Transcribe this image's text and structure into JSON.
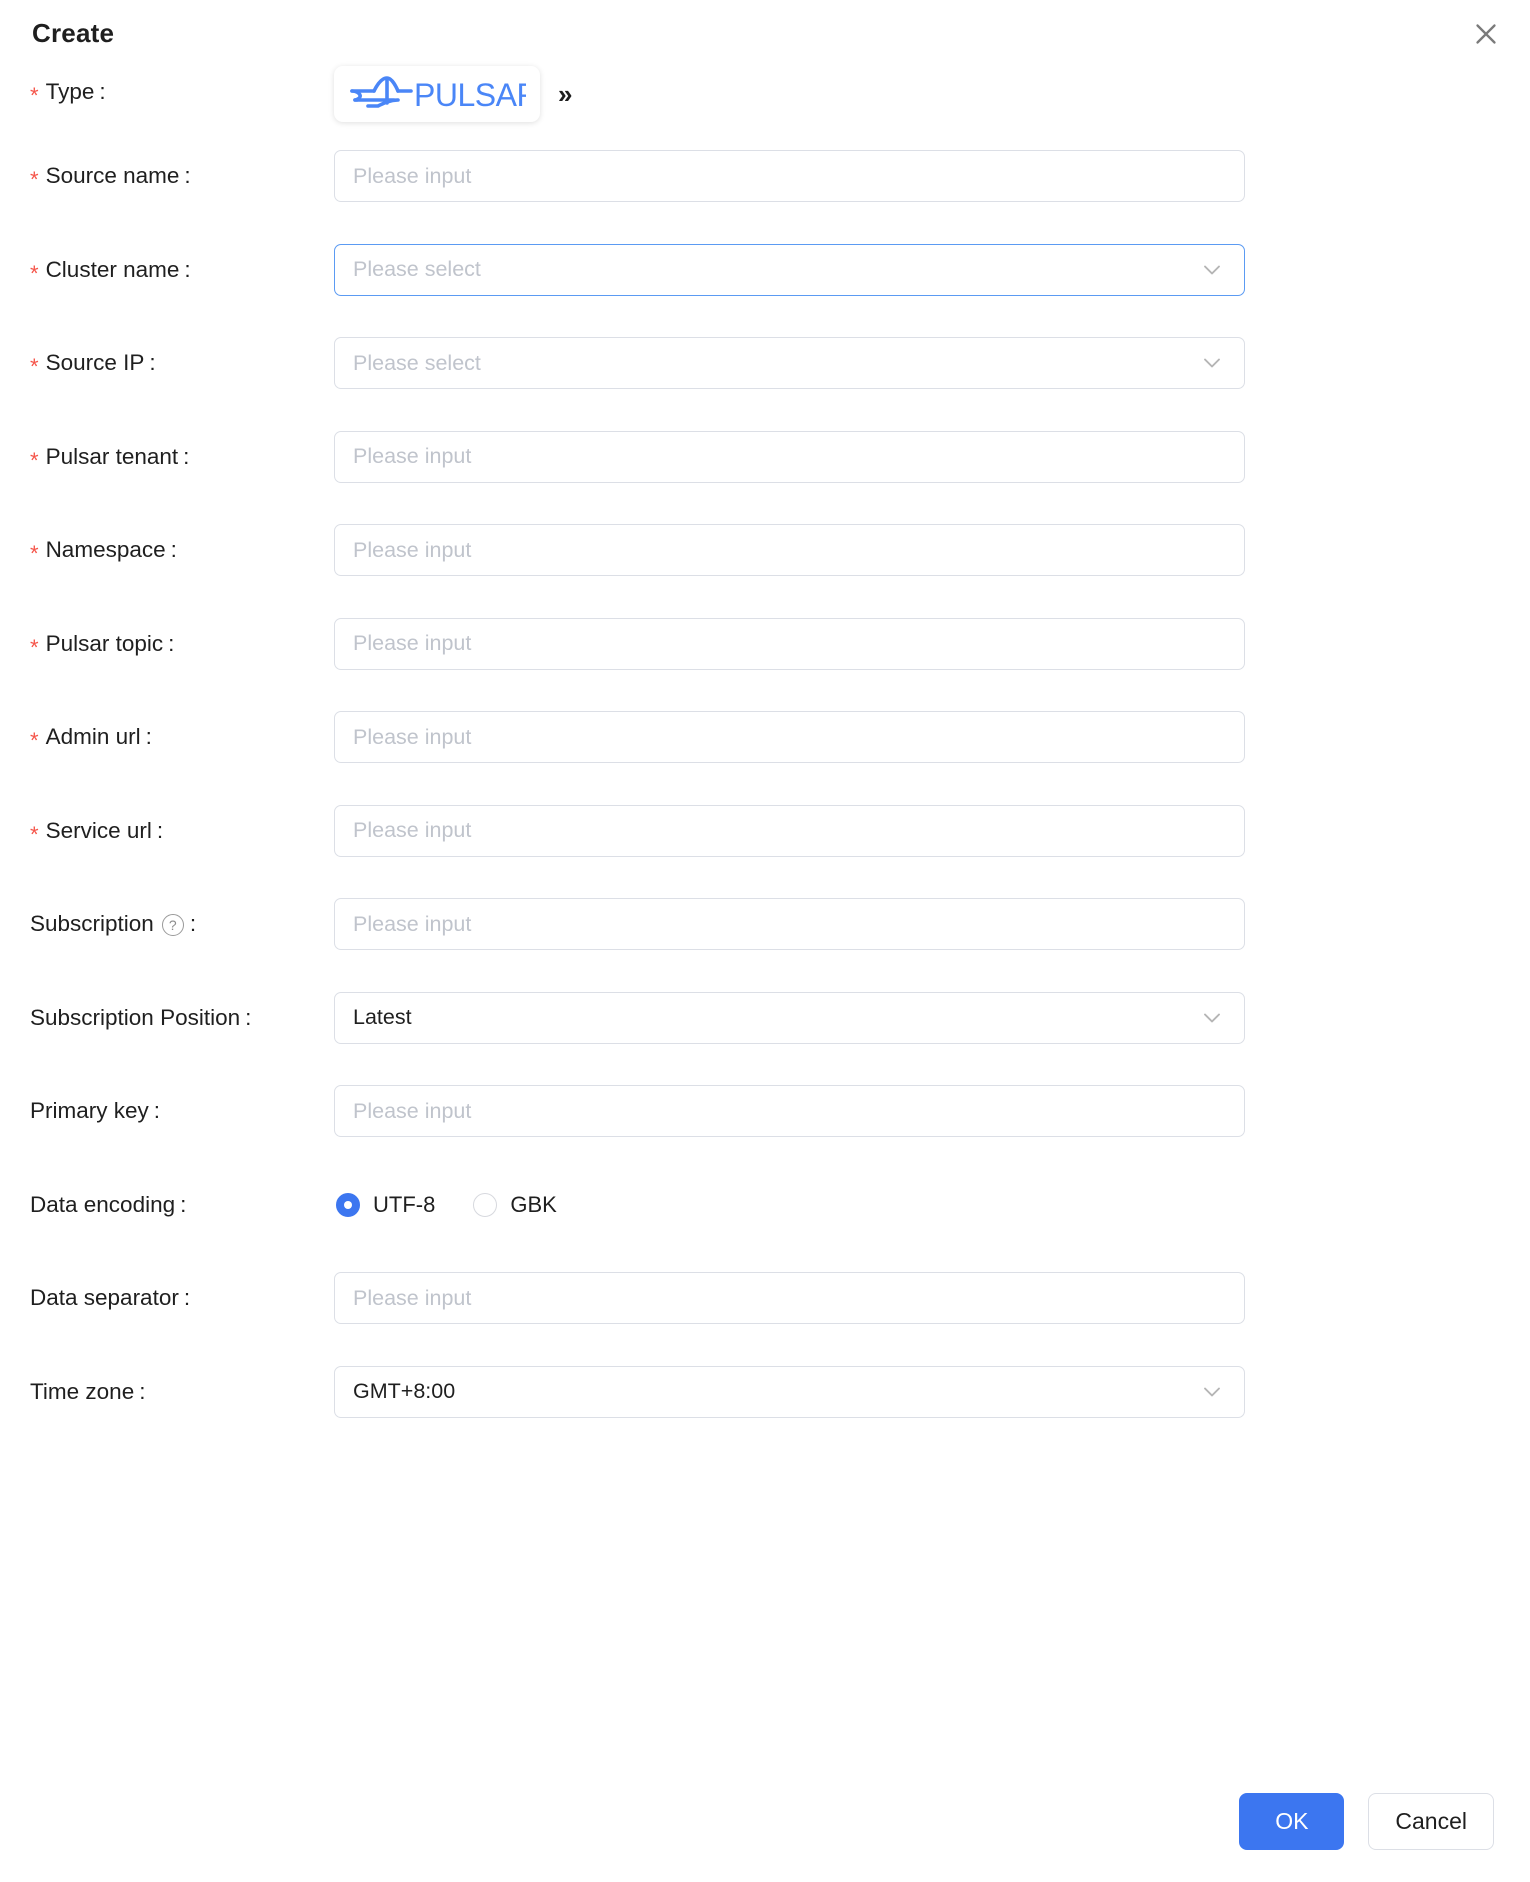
{
  "dialog": {
    "title": "Create",
    "close_icon": "close-icon"
  },
  "form": {
    "type": {
      "label": "Type",
      "required": true,
      "selected_logo_text": "PULSAR",
      "next_arrow": "»"
    },
    "fields": [
      {
        "key": "source_name",
        "label": "Source name",
        "required": true,
        "control": "input",
        "placeholder": "Please input",
        "value": ""
      },
      {
        "key": "cluster_name",
        "label": "Cluster name",
        "required": true,
        "control": "select",
        "placeholder": "Please select",
        "value": "",
        "focused": true
      },
      {
        "key": "source_ip",
        "label": "Source IP",
        "required": true,
        "control": "select",
        "placeholder": "Please select",
        "value": ""
      },
      {
        "key": "pulsar_tenant",
        "label": "Pulsar tenant",
        "required": true,
        "control": "input",
        "placeholder": "Please input",
        "value": ""
      },
      {
        "key": "namespace",
        "label": "Namespace",
        "required": true,
        "control": "input",
        "placeholder": "Please input",
        "value": ""
      },
      {
        "key": "pulsar_topic",
        "label": "Pulsar topic",
        "required": true,
        "control": "input",
        "placeholder": "Please input",
        "value": ""
      },
      {
        "key": "admin_url",
        "label": "Admin url",
        "required": true,
        "control": "input",
        "placeholder": "Please input",
        "value": ""
      },
      {
        "key": "service_url",
        "label": "Service url",
        "required": true,
        "control": "input",
        "placeholder": "Please input",
        "value": ""
      },
      {
        "key": "subscription",
        "label": "Subscription",
        "required": false,
        "control": "input",
        "placeholder": "Please input",
        "value": "",
        "help": "question-circle-icon"
      },
      {
        "key": "subscription_position",
        "label": "Subscription Position",
        "required": false,
        "control": "select",
        "placeholder": "",
        "value": "Latest"
      },
      {
        "key": "primary_key",
        "label": "Primary key",
        "required": false,
        "control": "input",
        "placeholder": "Please input",
        "value": ""
      },
      {
        "key": "data_encoding",
        "label": "Data encoding",
        "required": false,
        "control": "radio",
        "options": [
          "UTF-8",
          "GBK"
        ],
        "value": "UTF-8"
      },
      {
        "key": "data_separator",
        "label": "Data separator",
        "required": false,
        "control": "input",
        "placeholder": "Please input",
        "value": ""
      },
      {
        "key": "time_zone",
        "label": "Time zone",
        "required": false,
        "control": "select",
        "placeholder": "",
        "value": "GMT+8:00"
      }
    ]
  },
  "footer": {
    "ok_label": "OK",
    "cancel_label": "Cancel"
  },
  "colors": {
    "primary": "#3c76f0",
    "required_star": "#f5554a",
    "placeholder": "#c0c4cc",
    "border": "#dcdfe6",
    "focus_border": "#5b9bf3",
    "pulsar_blue": "#4a86f7"
  }
}
